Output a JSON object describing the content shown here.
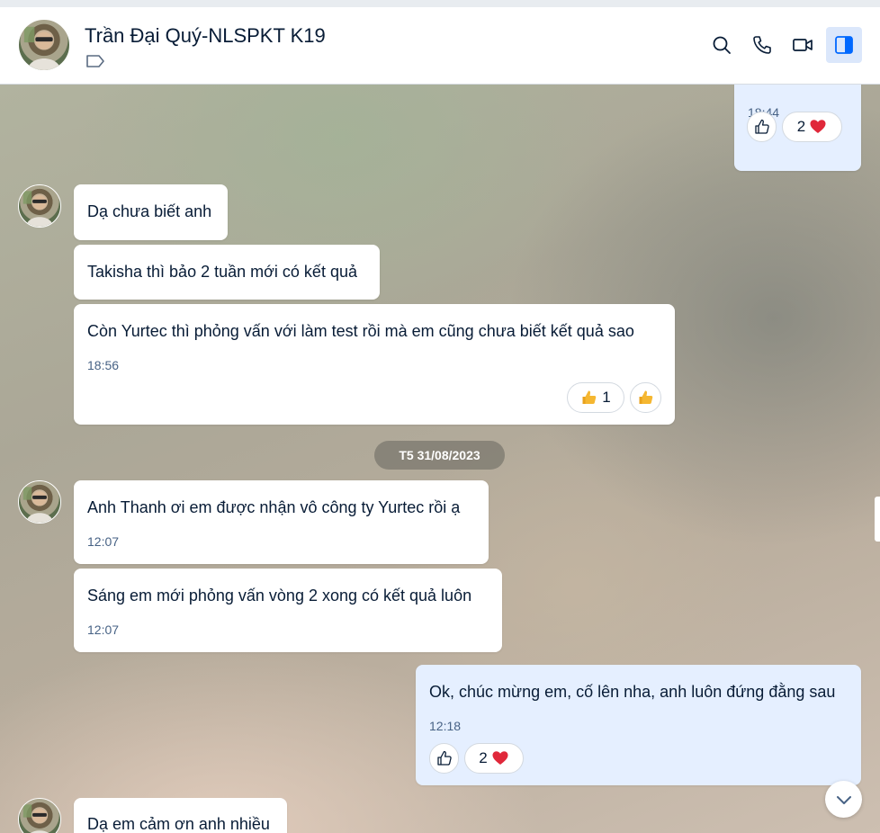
{
  "header": {
    "name": "Trần Đại Quý-NLSPKT K19",
    "icons": {
      "tag": "tag-icon",
      "search": "search-icon",
      "call": "phone-icon",
      "video": "video-icon",
      "panel": "sidebar-toggle-icon"
    }
  },
  "colors": {
    "accent": "#0068ff",
    "my_bubble": "#e5efff",
    "their_bubble": "#ffffff",
    "heart": "#e0283a",
    "thumb": "#f5b731"
  },
  "messages": [
    {
      "sender": "me",
      "text_partial": "",
      "time": "18:44",
      "reactions": [
        {
          "icon": "like-outline-icon"
        },
        {
          "icon": "heart-icon",
          "count": "2"
        }
      ]
    },
    {
      "sender": "them",
      "text": "Dạ chưa biết anh"
    },
    {
      "sender": "them",
      "text": "Takisha thì bảo 2 tuần mới có kết quả"
    },
    {
      "sender": "them",
      "text": "Còn Yurtec thì phỏng vấn với làm test rồi mà em cũng chưa biết kết quả sao",
      "time": "18:56",
      "reactions": [
        {
          "icon": "thumbs-up-icon",
          "count": "1"
        },
        {
          "icon": "thumbs-up-icon"
        }
      ]
    },
    {
      "sender": "them",
      "text": "Anh Thanh ơi em được nhận vô công ty Yurtec rồi ạ",
      "time": "12:07"
    },
    {
      "sender": "them",
      "text": "Sáng em mới phỏng vấn vòng 2 xong có kết quả luôn",
      "time": "12:07"
    },
    {
      "sender": "me",
      "text": "Ok, chúc mừng em, cố lên nha, anh luôn đứng đằng sau",
      "time": "12:18",
      "reactions": [
        {
          "icon": "like-outline-icon"
        },
        {
          "icon": "heart-icon",
          "count": "2"
        }
      ]
    },
    {
      "sender": "them",
      "text": "Dạ em cảm ơn anh nhiều"
    }
  ],
  "date_divider": "T5 31/08/2023"
}
